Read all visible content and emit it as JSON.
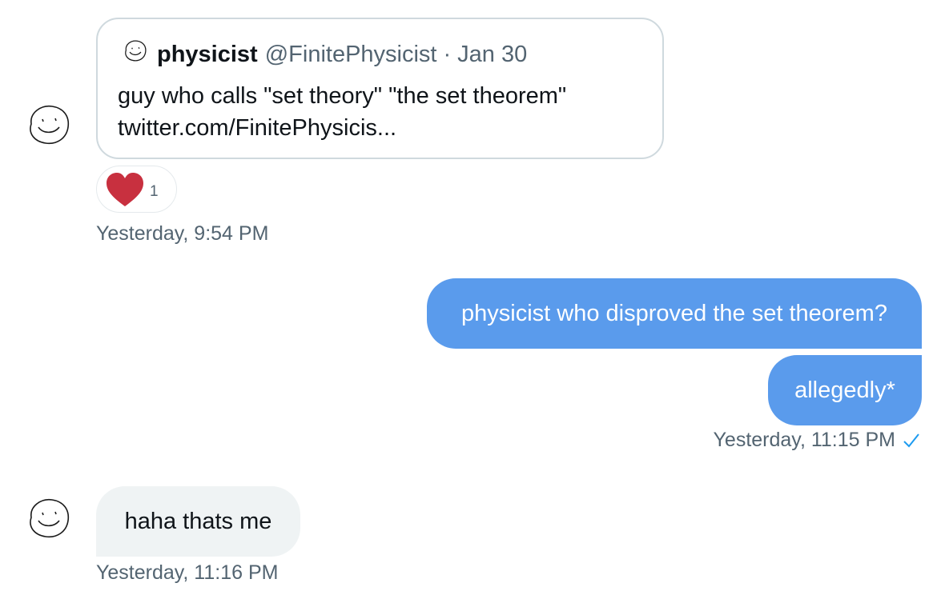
{
  "quoted_message": {
    "author_name": "physicist",
    "author_handle": "@FinitePhysicist",
    "separator": "·",
    "date": "Jan 30",
    "text_line_1": "guy who calls \"set theory\" \"the set theorem\"",
    "text_line_2": "twitter.com/FinitePhysicis..."
  },
  "reaction": {
    "icon": "heart-icon",
    "count": "1",
    "color": "#c8303f"
  },
  "messages": [
    {
      "direction": "received",
      "timestamp": "Yesterday, 9:54 PM"
    },
    {
      "direction": "sent",
      "text": "physicist who disproved the set theorem?"
    },
    {
      "direction": "sent",
      "text": "allegedly*"
    },
    {
      "direction": "sent-meta",
      "timestamp": "Yesterday, 11:15 PM",
      "status_icon": "check-icon"
    },
    {
      "direction": "received",
      "text": "haha thats me",
      "timestamp": "Yesterday, 11:16 PM"
    }
  ],
  "colors": {
    "sent_bubble": "#5a9bec",
    "received_bubble": "#eff3f4",
    "secondary_text": "#536471",
    "card_border": "#cfd9de"
  }
}
